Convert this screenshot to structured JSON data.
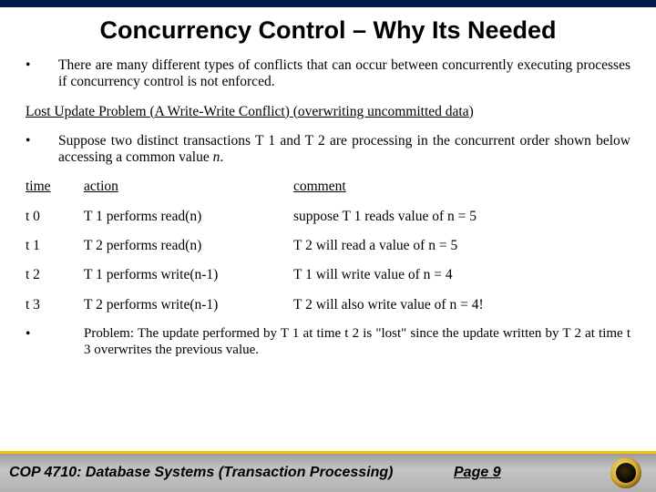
{
  "title": "Concurrency Control – Why Its Needed",
  "bullets": {
    "b1": "There are many different types of conflicts that can occur between concurrently executing processes if concurrency control is not enforced."
  },
  "subheading": "Lost Update Problem (A Write-Write Conflict) (overwriting uncommitted data)",
  "bullets2": {
    "b2_a": "Suppose two distinct transactions T 1 and T 2 are processing in the concurrent order shown below accessing a common value ",
    "b2_b": "n",
    "b2_c": "."
  },
  "table": {
    "head": {
      "c1": "time",
      "c2": "action",
      "c3": "comment"
    },
    "rows": [
      {
        "c1": "t 0",
        "c2": "T 1 performs read(n)",
        "c3": "suppose T 1 reads value of n = 5"
      },
      {
        "c1": "t 1",
        "c2": "T 2 performs read(n)",
        "c3": "T 2 will read a value of n = 5"
      },
      {
        "c1": "t 2",
        "c2": "T 1 performs write(n-1)",
        "c3": "T 1 will write value of n = 4"
      },
      {
        "c1": "t 3",
        "c2": "T 2 performs write(n-1)",
        "c3": "T 2 will also write value of n = 4!"
      }
    ]
  },
  "problem": "Problem:  The update performed by T 1 at time t 2 is \"lost\" since the update written by T 2 at time t 3 overwrites the previous value.",
  "footer": {
    "course": "COP 4710: Database Systems  (Transaction Processing)",
    "page": "Page 9"
  }
}
